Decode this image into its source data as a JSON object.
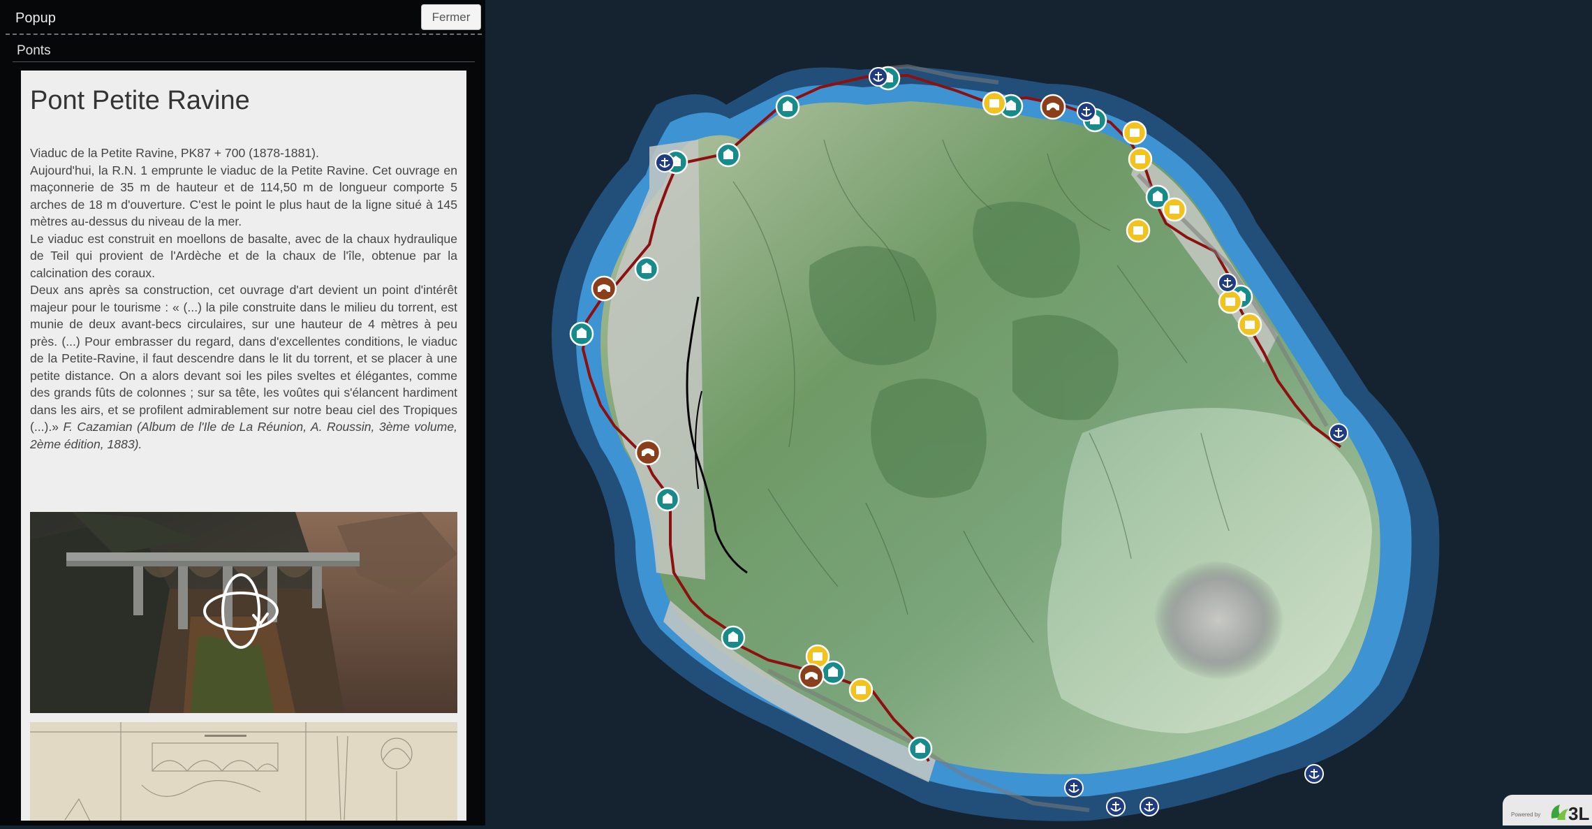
{
  "popup": {
    "title": "Popup",
    "close_label": "Fermer",
    "section": "Ponts",
    "bridge_title": "Pont Petite Ravine",
    "paragraphs": [
      "Viaduc de la Petite Ravine, PK87 + 700 (1878-1881).",
      "Aujourd'hui, la R.N. 1 emprunte le viaduc de la Petite Ravine. Cet ouvrage en maçonnerie de 35 m de hauteur et de 114,50 m de longueur comporte 5 arches de 18 m d'ouverture. C'est le point le plus haut de la ligne situé à 145 mètres au-dessus du niveau de la mer.",
      "Le viaduc est construit en moellons de basalte, avec de la chaux hydraulique de Teil qui provient de l'Ardèche et de la chaux de l'île, obtenue par la calcination des coraux."
    ],
    "quote_main": "Deux ans après sa construction, cet ouvrage d'art devient un point d'intérêt majeur pour le tourisme : « (...) la pile construite dans le milieu du torrent, est munie de deux avant-becs circulaires, sur une hauteur de 4 mètres à peu près. (...) Pour embrasser du regard, dans d'excellentes conditions, le viaduc de la Petite-Ravine, il faut descendre dans le lit du torrent, et se placer à une petite distance. On a alors devant soi les piles sveltes et élégantes, comme des grands fûts de colonnes ; sur sa tête, les voûtes qui s'élancent hardiment dans les airs, et se profilent admirablement sur notre beau ciel des Tropiques (...).»",
    "quote_citation": "F. Cazamian (Album de l'Ile de La Réunion, A. Roussin, 3ème volume, 2ème édition, 1883)."
  },
  "attribution": {
    "powered_by": "Powered by",
    "brand": "3L"
  },
  "colors": {
    "ocean": "#15222f",
    "shore_glow": "#3d8fd0",
    "rail_line": "#8d1010",
    "marker_teal": "#178a8a",
    "marker_yellow": "#f2c21e",
    "marker_brown": "#8a3f1a",
    "marker_navy": "#1f3c80"
  },
  "markers": {
    "station": {
      "icon": "station-icon"
    },
    "building": {
      "icon": "building-icon"
    },
    "bridge": {
      "icon": "bridge-arch-icon"
    },
    "anchor": {
      "icon": "anchor-icon"
    }
  }
}
